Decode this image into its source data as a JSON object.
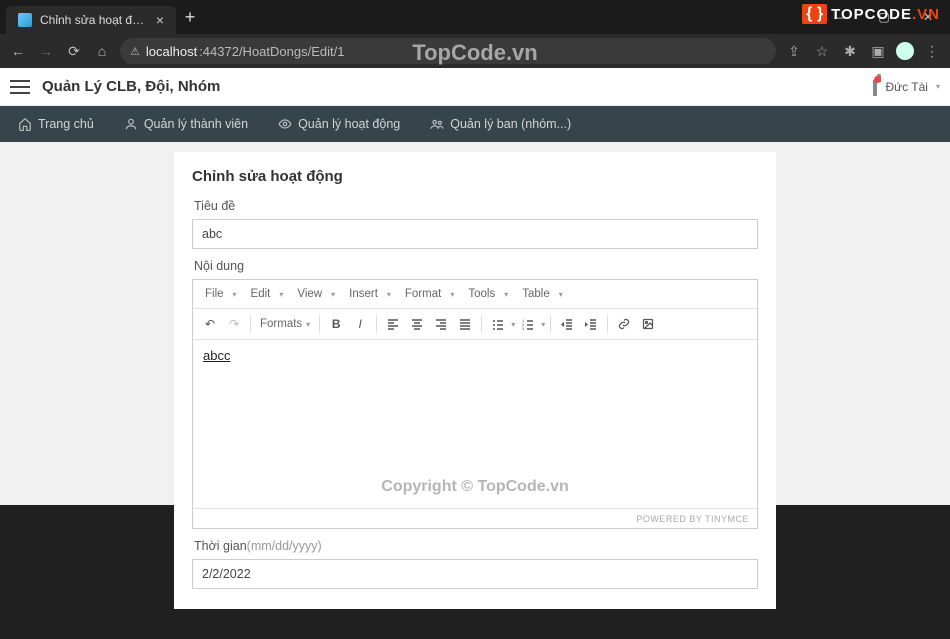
{
  "browser": {
    "tab_title": "Chỉnh sửa hoạt động",
    "url_host": "localhost",
    "url_port_path": ":44372/HoatDongs/Edit/1"
  },
  "watermark": {
    "top": "TopCode.vn",
    "copyright": "Copyright © TopCode.vn",
    "logo_text_a": "TOPCODE",
    "logo_text_b": ".VN"
  },
  "app": {
    "title": "Quản Lý CLB, Đội, Nhóm",
    "user_name": "Đức Tài",
    "nav": {
      "home": "Trang chủ",
      "members": "Quản lý thành viên",
      "activities": "Quản lý hoạt động",
      "teams": "Quản lý ban (nhóm...)"
    }
  },
  "form": {
    "heading": "Chỉnh sửa hoạt động",
    "title_label": "Tiêu đề",
    "title_value": "abc",
    "content_label": "Nội dung",
    "content_value": "abcc",
    "time_label": "Thời gian",
    "time_hint": "(mm/dd/yyyy)",
    "time_value": "2/2/2022"
  },
  "mce": {
    "menus": {
      "file": "File",
      "edit": "Edit",
      "view": "View",
      "insert": "Insert",
      "format": "Format",
      "tools": "Tools",
      "table": "Table"
    },
    "formats_label": "Formats",
    "powered": "POWERED BY TINYMCE"
  }
}
